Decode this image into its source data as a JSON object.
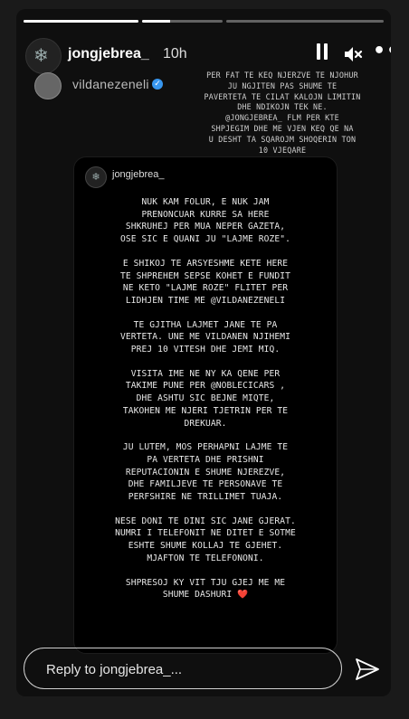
{
  "header": {
    "username": "jongjebrea_",
    "time": "10h"
  },
  "progress": [
    {
      "fill_percent": 100
    },
    {
      "fill_percent": 35
    },
    {
      "fill_percent": 0
    }
  ],
  "repost": {
    "username": "vildanezeneli",
    "caption": [
      "PER FAT TE KEQ NJERZVE TE NJOHUR",
      "JU NGJITEN PAS SHUME TE",
      "PAVERTETA  TE CILAT KALOJN LIMITIN",
      "DHE NDIKOJN TEK NE.",
      "@JONGJEBREA_  FLM PER KTE",
      "SHPJEGIM DHE ME VJEN KEQ QE NA",
      "U DESHT TA SQAROJM SHOQERIN TON",
      "10 VJEQARE"
    ]
  },
  "card": {
    "username": "jongjebrea_",
    "paragraphs": [
      [
        "NUK KAM FOLUR, E NUK JAM",
        "PRENONCUAR KURRE SA HERE",
        "SHKRUHEJ PER MUA NEPER GAZETA,",
        "OSE SIC E QUANI JU \"LAJME ROZE\"."
      ],
      [
        "E SHIKOJ TE ARSYESHME KETE HERE",
        "TE SHPREHEM SEPSE KOHET E FUNDIT",
        "NE KETO \"LAJME ROZE\" FLITET PER",
        "LIDHJEN TIME ME @VILDANEZENELI"
      ],
      [
        "TE GJITHA LAJMET JANE TE PA",
        "VERTETA. UNE ME VILDANEN NJIHEMI",
        "PREJ 10 VITESH DHE JEMI MIQ."
      ],
      [
        "VISITA IME NE NY KA QENE PER",
        "TAKIME PUNE PER @NOBLECICARS ,",
        "DHE ASHTU SIC BEJNE MIQTE,",
        "TAKOHEN ME NJERI TJETRIN PER TE",
        "DREKUAR."
      ],
      [
        "JU LUTEM, MOS PERHAPNI LAJME TE",
        "PA VERTETA DHE PRISHNI",
        "REPUTACIONIN E SHUME NJEREZVE,",
        "DHE FAMILJEVE TE PERSONAVE TE",
        "PERFSHIRE NE TRILLIMET TUAJA."
      ],
      [
        "NESE DONI TE DINI SIC JANE GJERAT.",
        "NUMRI I TELEFONIT NE DITET E SOTME",
        "ESHTE SHUME KOLLAJ TE GJEHET.",
        "MJAFTON TE TELEFONONI."
      ],
      [
        "SHPRESOJ KY VIT TJU GJEJ ME ME",
        "SHUME DASHURI"
      ]
    ],
    "heart": "❤️"
  },
  "reply": {
    "placeholder": "Reply to jongjebrea_..."
  },
  "icons": {
    "pause": "pause-icon",
    "mute": "mute-icon",
    "more": "more-icon",
    "send": "send-icon",
    "verified": "verified-badge-icon"
  }
}
